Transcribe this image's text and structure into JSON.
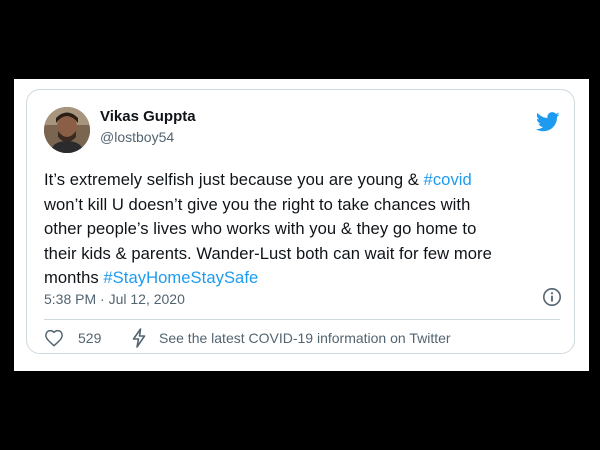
{
  "tweet": {
    "author": {
      "display_name": "Vikas Guppta",
      "handle": "@lostboy54"
    },
    "text_lines": [
      {
        "segments": [
          {
            "text": "It’s extremely selfish just because you are young & ",
            "type": "text"
          },
          {
            "text": "#covid",
            "type": "hashtag"
          }
        ]
      },
      {
        "segments": [
          {
            "text": "won’t kill U doesn’t give you the right to take chances with",
            "type": "text"
          }
        ]
      },
      {
        "segments": [
          {
            "text": "other people’s lives who works with you & they go home to",
            "type": "text"
          }
        ]
      },
      {
        "segments": [
          {
            "text": "their kids & parents. Wander-Lust both can wait for few more",
            "type": "text"
          }
        ]
      },
      {
        "segments": [
          {
            "text": "months ",
            "type": "text"
          },
          {
            "text": "#StayHomeStaySafe",
            "type": "hashtag"
          }
        ]
      }
    ],
    "timestamp": "5:38 PM · Jul 12, 2020",
    "like_count": "529",
    "covid_info_text": "See the latest COVID-19 information on Twitter"
  },
  "icons": {
    "brand": "twitter-bird-icon",
    "info": "info-icon",
    "like": "heart-icon",
    "covid": "lightning-icon"
  },
  "colors": {
    "page_background": "#000000",
    "card_background": "#ffffff",
    "brand_blue": "#1d9bf0",
    "primary_text": "#0f1419",
    "secondary_text": "#536471",
    "border": "#cfd9de"
  }
}
